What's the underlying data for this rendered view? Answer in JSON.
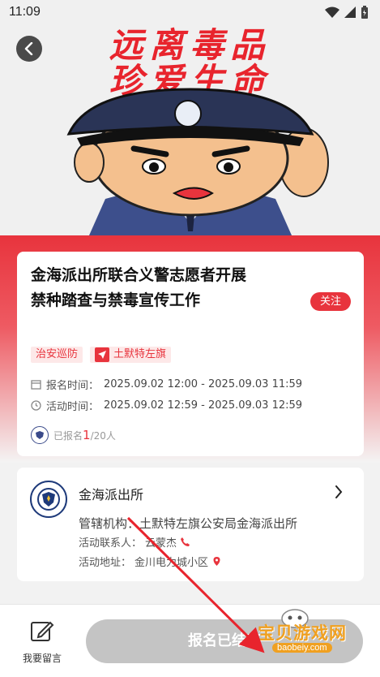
{
  "status_bar": {
    "time": "11:09"
  },
  "banner": {
    "slogan_line1": "远离毒品",
    "slogan_line2": "珍爱生命"
  },
  "activity": {
    "title": "金海派出所联合义警志愿者开展禁种踏查与禁毒宣传工作",
    "follow_label": "关注",
    "tags": [
      "治安巡防",
      "土默特左旗"
    ],
    "signup_time_label": "报名时间：",
    "signup_time_value": "2025.09.02 12:00 - 2025.09.03 11:59",
    "activity_time_label": "活动时间：",
    "activity_time_value": "2025.09.02 12:59 - 2025.09.03 12:59",
    "signed_prefix": "已报名",
    "signed_count": "1",
    "signed_total": "/20人"
  },
  "station": {
    "name": "金海派出所",
    "org_label": "管辖机构：",
    "org_value": "土默特左旗公安局金海派出所",
    "contact_label": "活动联系人：",
    "contact_value": "云蒙杰",
    "address_label": "活动地址：",
    "address_value": "金川电力城小区"
  },
  "bottom": {
    "message_label": "我要留言",
    "ended_label": "报名已结束"
  },
  "watermark": {
    "text": "宝贝游戏网",
    "url": "baobeiy.com"
  },
  "colors": {
    "accent": "#e8343d",
    "disabled": "#c4c4c4"
  }
}
